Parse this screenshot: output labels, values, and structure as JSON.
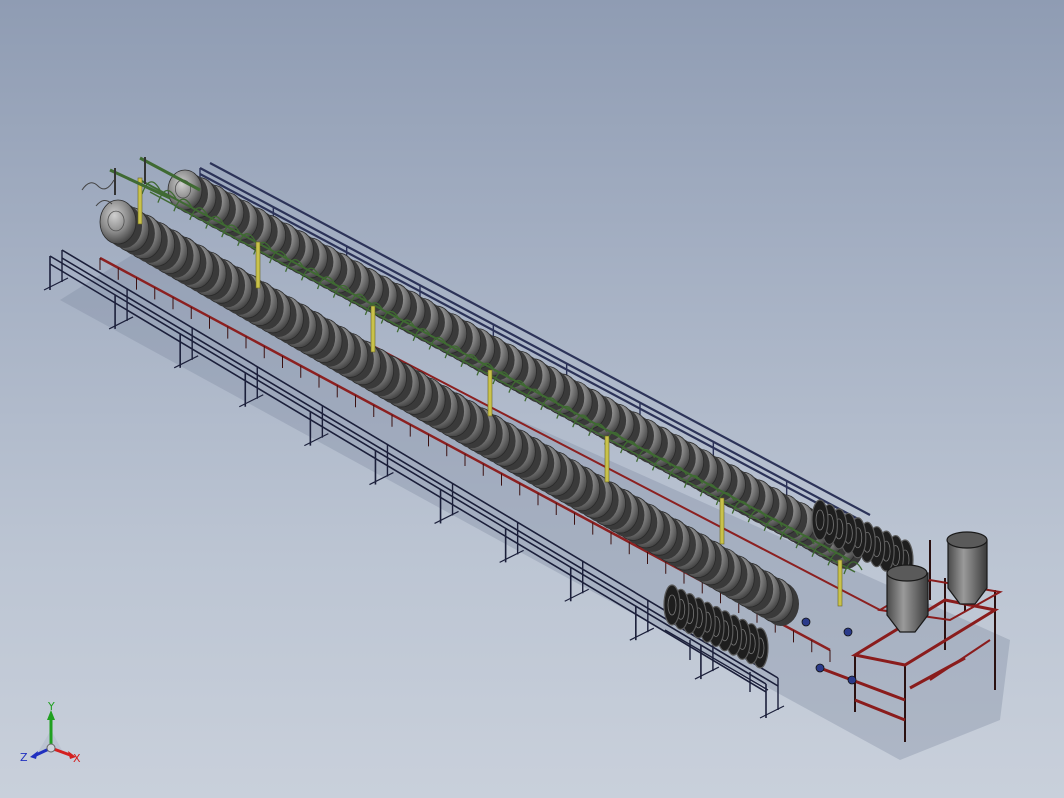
{
  "viewport": {
    "background_top": "#8f9cb3",
    "background_bottom": "#c9d0db"
  },
  "model": {
    "frame_color": "#1b1f3a",
    "rail_color": "#2c3358",
    "drum_color": "#8a8a8a",
    "pipe_red": "#8c2020",
    "pipe_green": "#3f6a32",
    "column_yellow": "#c9c24a",
    "tank_color": "#707070"
  },
  "triad": {
    "x_label": "X",
    "y_label": "Y",
    "z_label": "Z",
    "x_color": "#d42020",
    "y_color": "#20a020",
    "z_color": "#2030c0"
  }
}
